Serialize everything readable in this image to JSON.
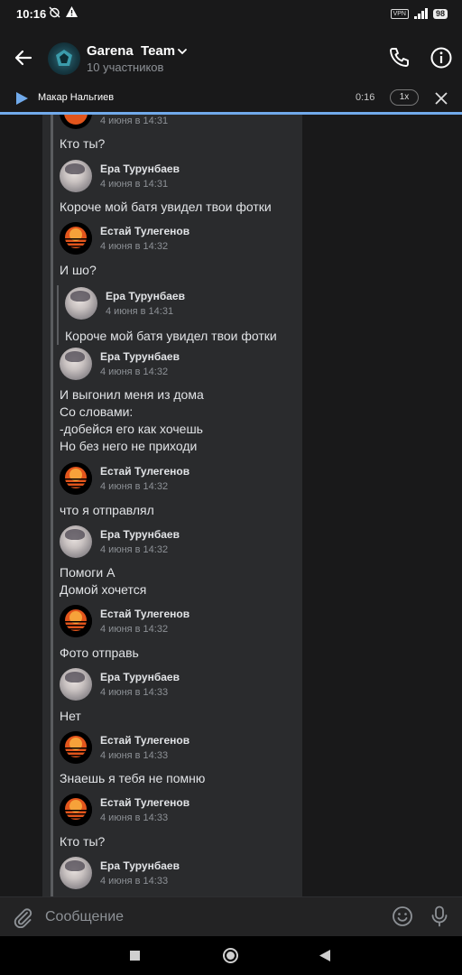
{
  "status_bar": {
    "time": "10:16",
    "battery": "98",
    "vpn": "VPN"
  },
  "header": {
    "title": "Garena  Team",
    "subtitle": "10 участников"
  },
  "player": {
    "name": "Макар Нальгиев",
    "time": "0:16",
    "speed": "1x"
  },
  "messages": [
    {
      "type": "text",
      "text": "Кто ты?"
    },
    {
      "type": "author",
      "name": "Ера Турунбаев",
      "time": "4 июня в 14:31",
      "avatar": "era"
    },
    {
      "type": "text",
      "text": "Короче мой батя увидел твои фотки"
    },
    {
      "type": "author",
      "name": "Естай Тулегенов",
      "time": "4 июня в 14:32",
      "avatar": "estai"
    },
    {
      "type": "text",
      "text": "И шо?"
    },
    {
      "type": "reply_author",
      "name": "Ера Турунбаев",
      "time": "4 июня в 14:31",
      "avatar": "era"
    },
    {
      "type": "reply_text",
      "text": "Короче мой батя увидел твои фотки"
    },
    {
      "type": "author",
      "name": "Ера Турунбаев",
      "time": "4 июня в 14:32",
      "avatar": "era"
    },
    {
      "type": "text",
      "lines": [
        "И выгонил меня из дома",
        "Со словами:",
        "-добейся его как хочешь",
        "Но без него не приходи"
      ]
    },
    {
      "type": "author",
      "name": "Естай Тулегенов",
      "time": "4 июня в 14:32",
      "avatar": "estai"
    },
    {
      "type": "text",
      "text": "что я отправлял"
    },
    {
      "type": "author",
      "name": "Ера Турунбаев",
      "time": "4 июня в 14:32",
      "avatar": "era"
    },
    {
      "type": "text",
      "lines": [
        "Помоги А",
        "Домой хочется"
      ]
    },
    {
      "type": "author",
      "name": "Естай Тулегенов",
      "time": "4 июня в 14:32",
      "avatar": "estai"
    },
    {
      "type": "text",
      "text": "Фото отправь"
    },
    {
      "type": "author",
      "name": "Ера Турунбаев",
      "time": "4 июня в 14:33",
      "avatar": "era"
    },
    {
      "type": "text",
      "text": "Нет"
    },
    {
      "type": "author",
      "name": "Естай Тулегенов",
      "time": "4 июня в 14:33",
      "avatar": "estai"
    },
    {
      "type": "text",
      "text": "Знаешь я тебя не помню"
    },
    {
      "type": "author",
      "name": "Естай Тулегенов",
      "time": "4 июня в 14:33",
      "avatar": "estai"
    },
    {
      "type": "text",
      "text": "Кто ты?"
    },
    {
      "type": "author",
      "name": "Ера Турунбаев",
      "time": "4 июня в 14:33",
      "avatar": "era"
    }
  ],
  "top_partial_time": "4 июня в 14:31",
  "input": {
    "placeholder": "Сообщение"
  },
  "colors": {
    "accent": "#71aaeb",
    "background": "#19191a",
    "bubble": "#2a2b2d"
  }
}
